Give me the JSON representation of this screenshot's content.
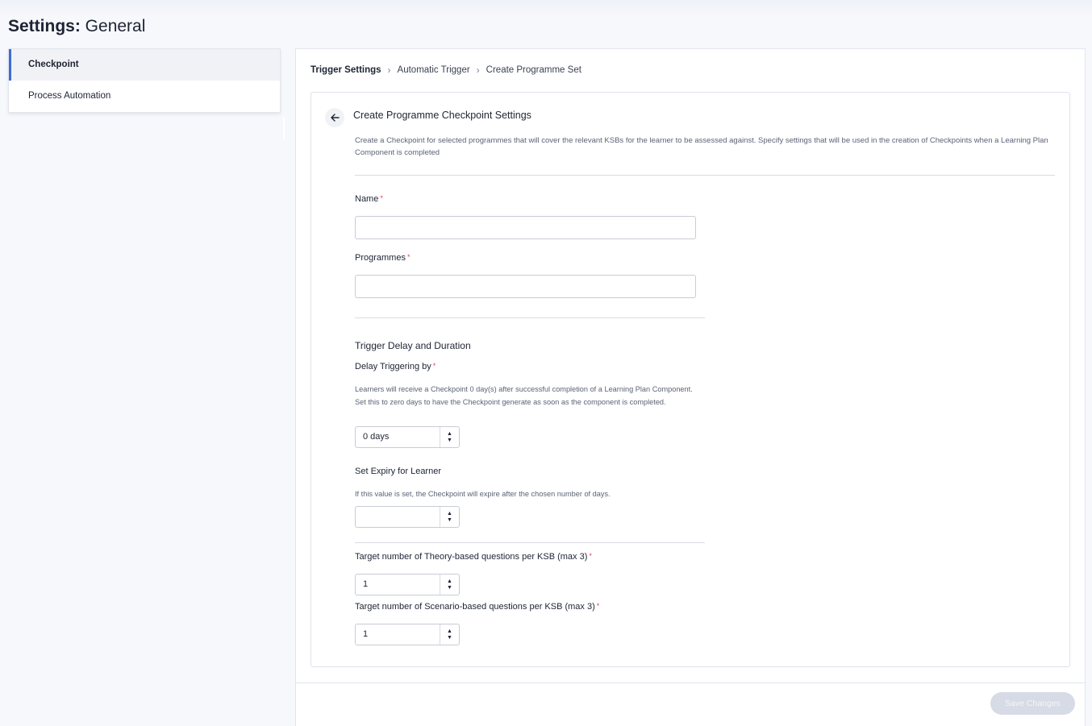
{
  "page": {
    "title_bold": "Settings:",
    "title_rest": " General"
  },
  "sidebar": {
    "items": [
      {
        "label": "Checkpoint"
      },
      {
        "label": "Process Automation"
      }
    ]
  },
  "breadcrumb": [
    "Trigger Settings",
    "Automatic Trigger",
    "Create Programme Set"
  ],
  "card": {
    "title": "Create Programme Checkpoint Settings",
    "description": "Create a Checkpoint for selected programmes that will cover the relevant KSBs for the learner to be assessed against. Specify settings that will be used in the creation of Checkpoints when a Learning Plan Component is completed"
  },
  "form": {
    "name_label": "Name",
    "name_value": "",
    "programmes_label": "Programmes",
    "programmes_value": "",
    "required_mark": "*",
    "trigger_section_title": "Trigger Delay and Duration",
    "delay_label": "Delay Triggering by",
    "delay_help": "Learners will receive a Checkpoint 0 day(s) after successful completion of a Learning Plan Component. Set this to zero days to have the Checkpoint generate as soon as the component is completed.",
    "delay_value": "0 days",
    "expiry_label": "Set Expiry for Learner",
    "expiry_help": "If this value is set, the Checkpoint will expire after the chosen number of days.",
    "expiry_value": "",
    "theory_label": "Target number of Theory-based questions per KSB (max 3)",
    "theory_value": "1",
    "scenario_label": "Target number of Scenario-based questions per KSB (max 3)",
    "scenario_value": "1"
  },
  "footer": {
    "save_label": "Save Changes"
  },
  "colors": {
    "accent": "#3f6ad8",
    "required": "#e0425a",
    "disabled_button": "#d6dbe5"
  }
}
